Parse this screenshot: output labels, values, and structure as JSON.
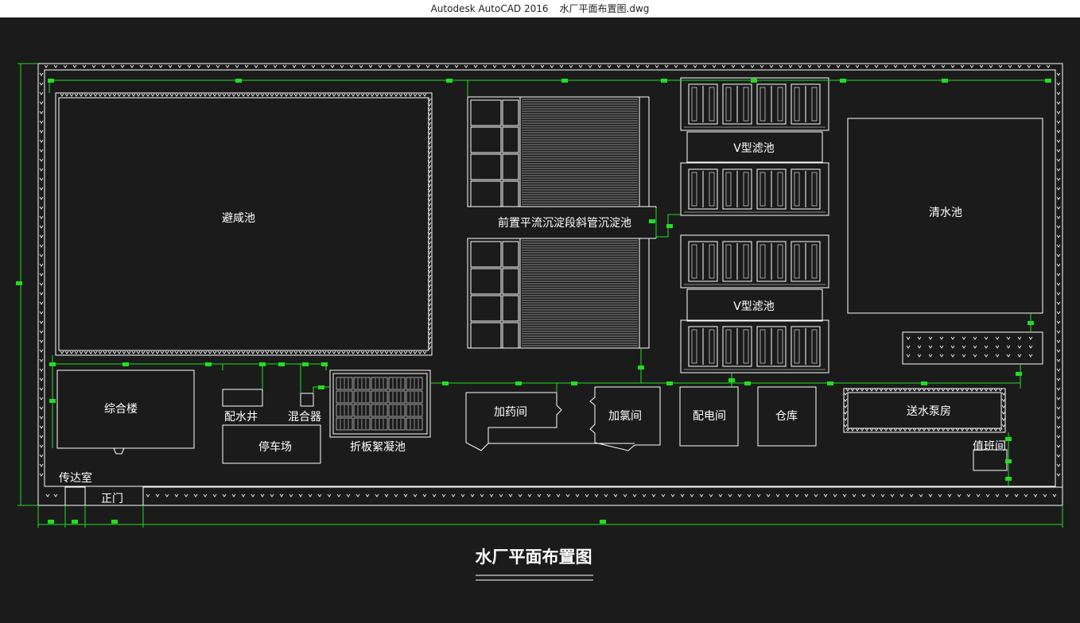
{
  "window": {
    "app_title": "Autodesk AutoCAD 2016",
    "file_name": "水厂平面布置图.dwg"
  },
  "drawing": {
    "title": "水厂平面布置图",
    "labels": {
      "detention_pond": "避咸池",
      "sedimentation": "前置平流沉淀段斜管沉淀池",
      "v_filter_upper": "V型滤池",
      "v_filter_lower": "V型滤池",
      "clear_water": "清水池",
      "office": "综合楼",
      "distribution_well": "配水井",
      "mixer": "混合器",
      "parking": "停车场",
      "flocculation": "折板絮凝池",
      "dosing_room": "加药间",
      "chlorination_room": "加氯间",
      "power_room": "配电间",
      "warehouse": "仓库",
      "pump_house": "送水泵房",
      "duty_room": "值班间",
      "guard_room": "传达室",
      "main_gate": "正门"
    }
  },
  "colors": {
    "background": "#1b1b1b",
    "line": "#ffffff",
    "dimension": "#22dd22"
  }
}
